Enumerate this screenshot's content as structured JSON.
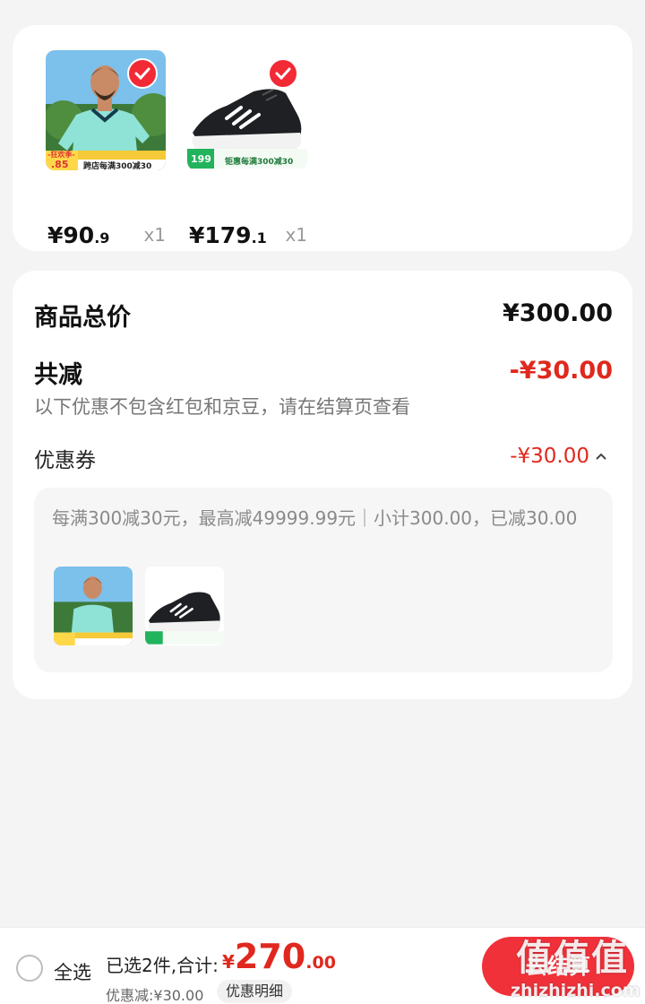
{
  "products": [
    {
      "price_int": "¥90",
      "price_dec": ".9",
      "qty": "x1",
      "badge_label": "-狂欢季-",
      "badge_price": ".85",
      "promo_line": "跨店每满300减30",
      "selected": true
    },
    {
      "price_int": "¥179",
      "price_dec": ".1",
      "qty": "x1",
      "badge_price": "199",
      "promo_line": "钜惠每满300减30",
      "selected": true
    }
  ],
  "summary": {
    "total_label": "商品总价",
    "total_value": "¥300.00",
    "reduce_label": "共减",
    "reduce_value": "-¥30.00",
    "hint": "以下优惠不包含红包和京豆，请在结算页查看",
    "coupon_label": "优惠券",
    "coupon_value": "-¥30.00",
    "coupon_desc": "每满300减30元，最高减49999.99元｜小计300.00，已减30.00"
  },
  "bottom_bar": {
    "select_all": "全选",
    "selected_info": "已选2件,合计:",
    "total_currency": "¥",
    "total_int": "270",
    "total_dec": ".00",
    "discount": "优惠减:¥30.00",
    "detail_button": "优惠明细",
    "checkout_button": "去结算"
  },
  "watermark": {
    "big": "值值值",
    "small": "zhizhizhi.com"
  },
  "colors": {
    "accent_red": "#e0281e",
    "button_red": "#f0313a",
    "promo_green": "#22b35d"
  },
  "icons": {
    "selected": "check-circle-icon",
    "expand": "chevron-up-icon",
    "unselected": "radio-empty-icon"
  }
}
